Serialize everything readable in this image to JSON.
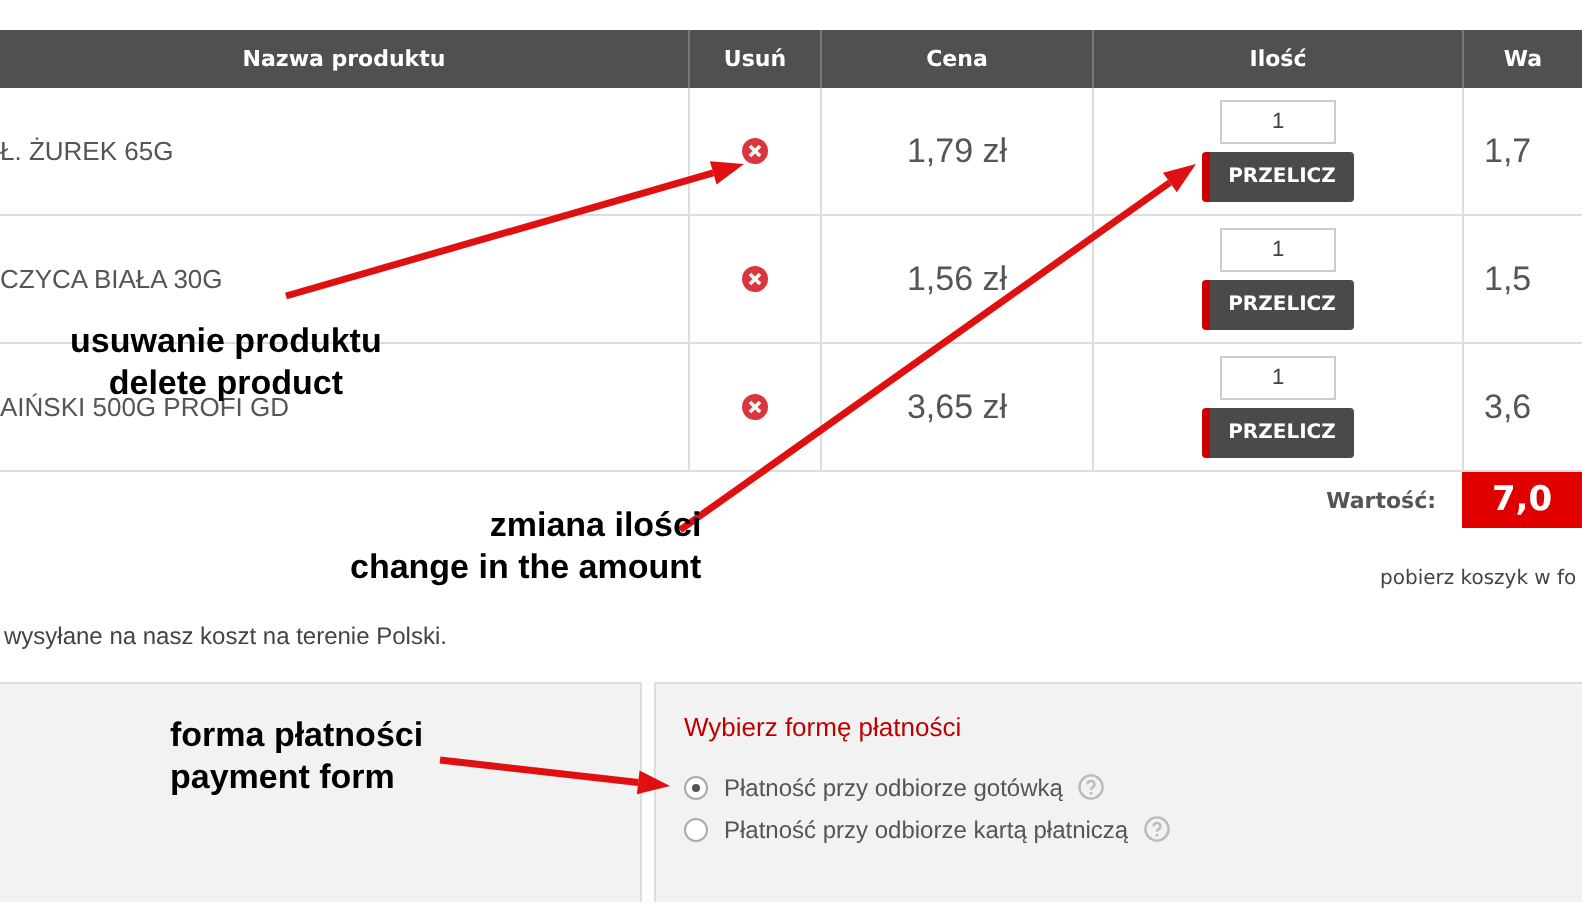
{
  "table": {
    "columns": [
      "Nazwa produktu",
      "Usuń",
      "Cena",
      "Ilość",
      "Wa"
    ],
    "rows": [
      {
        "name": "Ł. ŻUREK 65G",
        "price": "1,79 zł",
        "quantity": "1",
        "recalc_label": "PRZELICZ",
        "value": "1,7"
      },
      {
        "name": "CZYCA BIAŁA 30G",
        "price": "1,56 zł",
        "quantity": "1",
        "recalc_label": "PRZELICZ",
        "value": "1,5"
      },
      {
        "name": "AIŃSKI 500G PROFI GD",
        "price": "3,65 zł",
        "quantity": "1",
        "recalc_label": "PRZELICZ",
        "value": "3,6"
      }
    ],
    "total": {
      "label": "Wartość:",
      "value": "7,0"
    }
  },
  "download_link": "pobierz koszyk w fo",
  "shipping_note": "wysyłane na nasz koszt na terenie Polski.",
  "payment": {
    "title": "Wybierz formę płatności",
    "options": [
      {
        "label": "Płatność przy odbiorze gotówką",
        "selected": true
      },
      {
        "label": "Płatność przy odbiorze kartą płatniczą",
        "selected": false
      }
    ]
  },
  "annotations": [
    {
      "lines": [
        "usuwanie produktu",
        "delete product"
      ]
    },
    {
      "lines": [
        "zmiana ilości",
        "change in the amount"
      ]
    },
    {
      "lines": [
        "forma płatności",
        "payment form"
      ]
    }
  ]
}
